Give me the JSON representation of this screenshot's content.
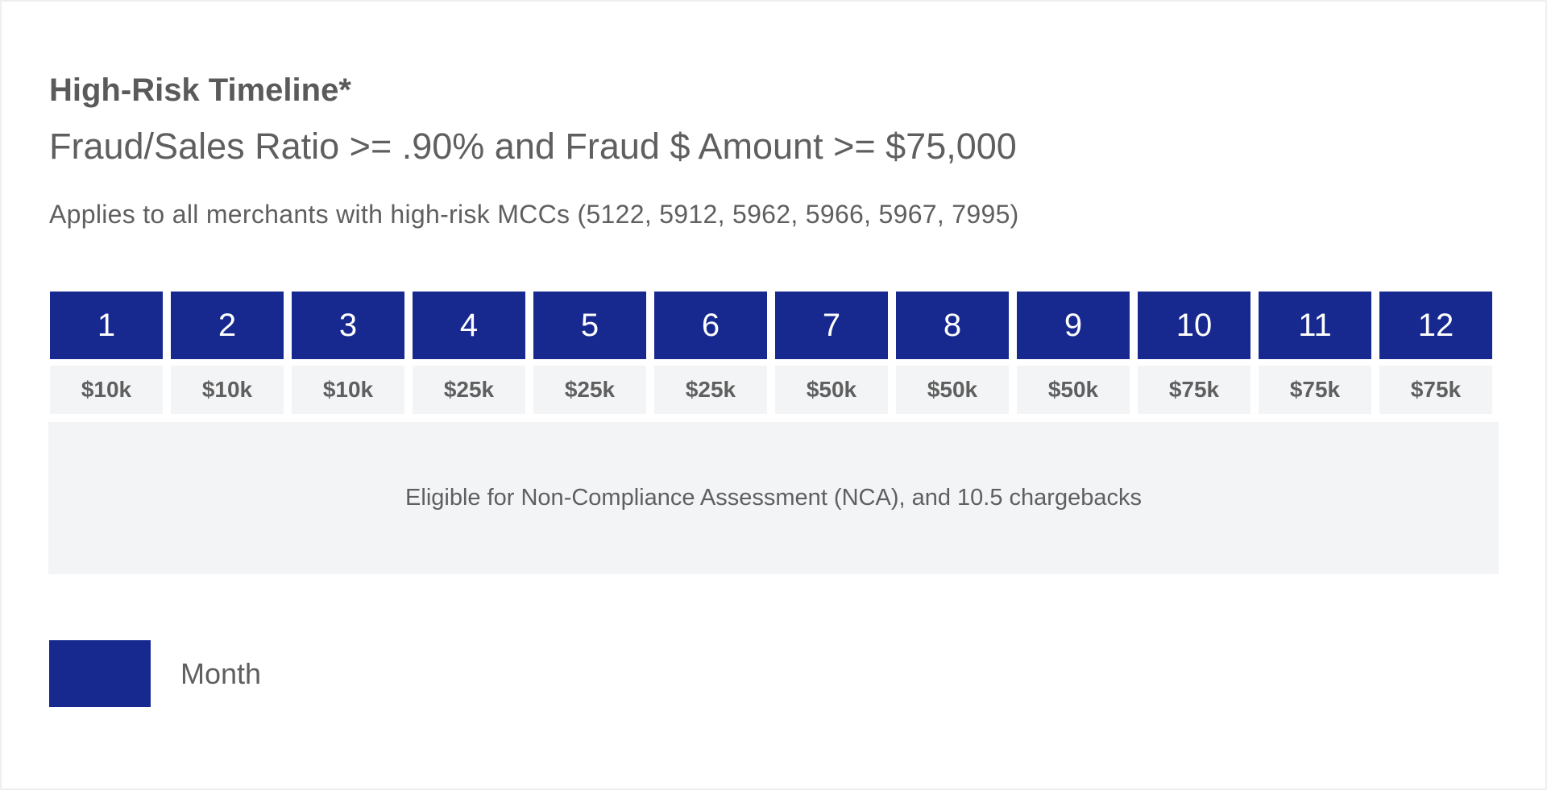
{
  "header": {
    "title": "High-Risk Timeline*",
    "subtitle": "Fraud/Sales Ratio >= .90% and Fraud $ Amount >= $75,000",
    "applies": "Applies to all merchants with high-risk MCCs (5122, 5912, 5962, 5966, 5967, 7995)"
  },
  "timeline": {
    "months": [
      "1",
      "2",
      "3",
      "4",
      "5",
      "6",
      "7",
      "8",
      "9",
      "10",
      "11",
      "12"
    ],
    "amounts": [
      "$10k",
      "$10k",
      "$10k",
      "$25k",
      "$25k",
      "$25k",
      "$50k",
      "$50k",
      "$50k",
      "$75k",
      "$75k",
      "$75k"
    ],
    "month_color": "#17298f",
    "note": "Eligible for Non-Compliance Assessment (NCA), and 10.5 chargebacks"
  },
  "legend": {
    "label": "Month",
    "color": "#17298f"
  }
}
